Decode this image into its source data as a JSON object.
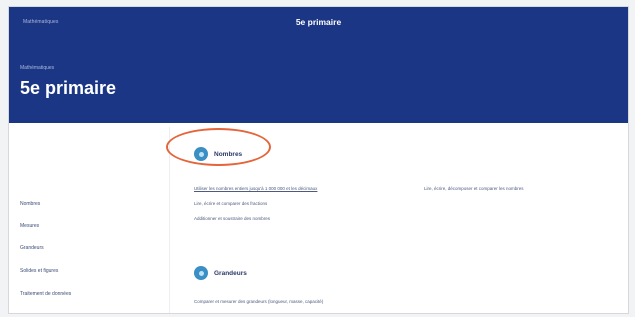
{
  "topbar": {
    "link": "Mathématiques",
    "title": "5e primaire"
  },
  "header": {
    "breadcrumb": "Mathématiques",
    "title": "5e primaire"
  },
  "sidebar": {
    "items": [
      {
        "label": "Nombres"
      },
      {
        "label": "Mesures"
      },
      {
        "label": "Grandeurs"
      },
      {
        "label": "Solides et figures"
      },
      {
        "label": "Traitement de données"
      }
    ]
  },
  "sections": [
    {
      "title": "Nombres",
      "items": [
        {
          "text": "Utiliser les nombres entiers jusqu'à 1 000 000 et les décimaux",
          "extra": "Lire, écrire, décomposer et comparer les nombres"
        },
        {
          "text": "Lire, écrire et comparer des fractions"
        },
        {
          "text": "Additionner et soustraire des nombres"
        }
      ]
    },
    {
      "title": "Grandeurs",
      "items": [
        {
          "text": "Comparer et mesurer des grandeurs (longueur, masse, capacité)"
        }
      ]
    }
  ],
  "colors": {
    "header_bg": "#1a3684",
    "accent": "#3a8fc4",
    "annotation": "#e5643a"
  }
}
